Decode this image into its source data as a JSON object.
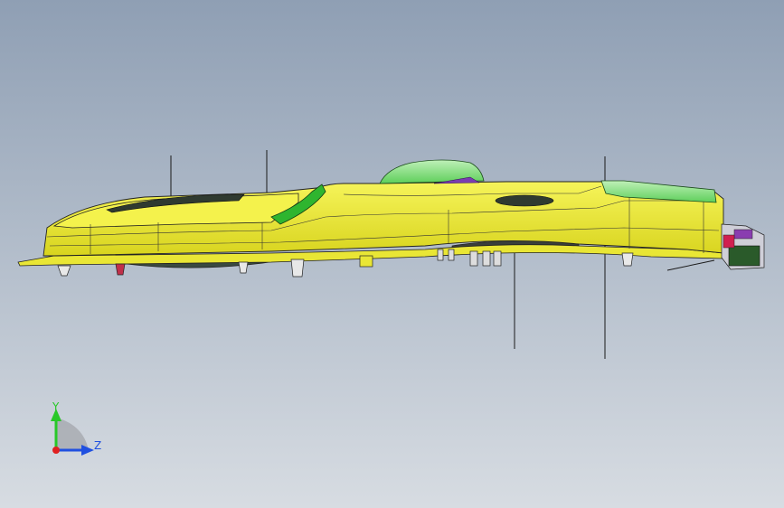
{
  "viewport": {
    "background_top": "#8f9fb4",
    "background_bottom": "#d7dce2"
  },
  "model": {
    "body_color": "#f2f03a",
    "body_shade": "#d6d21c",
    "edge_color": "#222222",
    "cover_color": "#8fe08a",
    "bracket_color": "#2fb52f",
    "dark_part": "#3a3f3a",
    "purple_part": "#7a3db0"
  },
  "triad": {
    "y_label": "Y",
    "z_label": "Z",
    "y_color": "#28c828",
    "z_color": "#2050e0",
    "x_color": "#e02020"
  }
}
